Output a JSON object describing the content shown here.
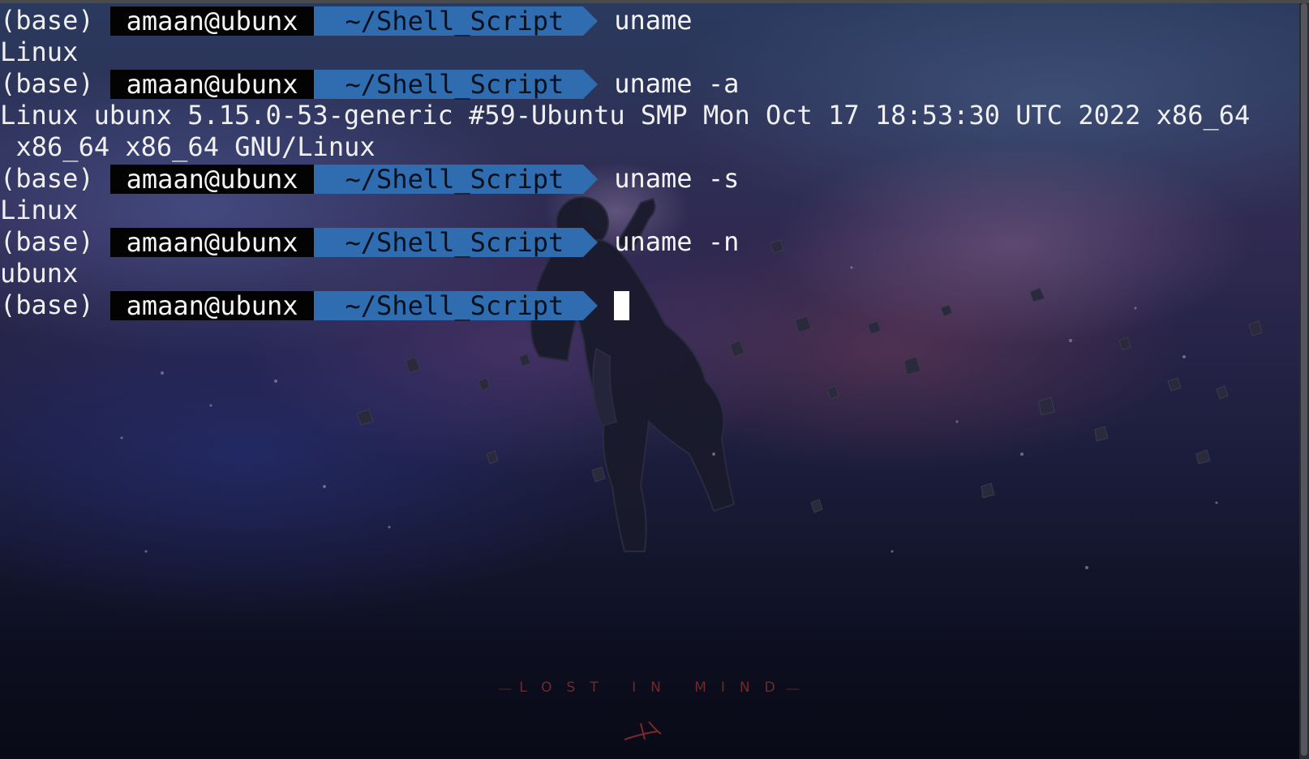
{
  "terminal": {
    "lines": [
      {
        "type": "prompt",
        "env": "(base)",
        "user": "amaan@ubunx",
        "dir": "~/Shell_Script",
        "command": "uname"
      },
      {
        "type": "output",
        "text": "Linux"
      },
      {
        "type": "prompt",
        "env": "(base)",
        "user": "amaan@ubunx",
        "dir": "~/Shell_Script",
        "command": "uname -a"
      },
      {
        "type": "output",
        "text": "Linux ubunx 5.15.0-53-generic #59-Ubuntu SMP Mon Oct 17 18:53:30 UTC 2022 x86_64"
      },
      {
        "type": "output",
        "text": "x86_64 x86_64 GNU/Linux"
      },
      {
        "type": "prompt",
        "env": "(base)",
        "user": "amaan@ubunx",
        "dir": "~/Shell_Script",
        "command": "uname -s"
      },
      {
        "type": "output",
        "text": "Linux"
      },
      {
        "type": "prompt",
        "env": "(base)",
        "user": "amaan@ubunx",
        "dir": "~/Shell_Script",
        "command": "uname -n"
      },
      {
        "type": "output",
        "text": "ubunx"
      },
      {
        "type": "prompt",
        "env": "(base)",
        "user": "amaan@ubunx",
        "dir": "~/Shell_Script",
        "command": ""
      }
    ]
  },
  "wallpaper": {
    "caption": "LOST IN MIND",
    "subject": "astronaut-floating-among-asteroids"
  },
  "colors": {
    "user_segment_bg": "#030303",
    "dir_segment_bg": "#2f6cb0",
    "dir_segment_fg": "#06111f",
    "text": "#f0f0f0",
    "cursor": "#ffffff"
  }
}
